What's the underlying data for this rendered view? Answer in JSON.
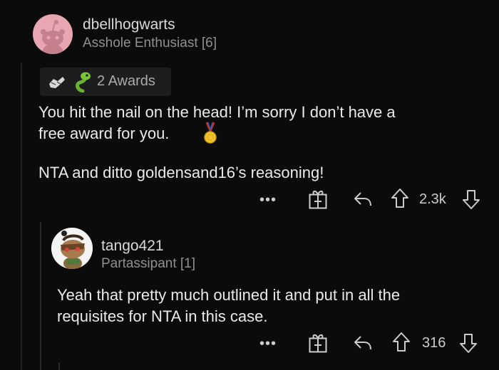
{
  "comment": {
    "username": "dbellhogwarts",
    "flair": "Asshole Enthusiast [6]",
    "awards_label": "2 Awards",
    "body_line1": "You hit the nail on the head! I’m sorry I don’t have a",
    "body_line2": "free award for you.",
    "body_para2": "NTA and ditto goldensand16’s reasoning!",
    "more_label": "•••",
    "score": "2.3k",
    "icons": {
      "award": "gift-icon",
      "reply": "reply-arrow-icon",
      "upvote": "upvote-arrow-icon",
      "downvote": "downvote-arrow-icon",
      "medal": "medal-emoji-icon"
    }
  },
  "reply": {
    "username": "tango421",
    "flair": "Partassipant [1]",
    "body_line1": "Yeah that pretty much outlined it and put in all the",
    "body_line2": "requisites for NTA in this case.",
    "more_label": "•••",
    "score": "316"
  },
  "colors": {
    "background": "#0b0b0b",
    "text": "#e8eaeb",
    "muted": "#8d9194",
    "avatar1": "#e8a6b2"
  }
}
